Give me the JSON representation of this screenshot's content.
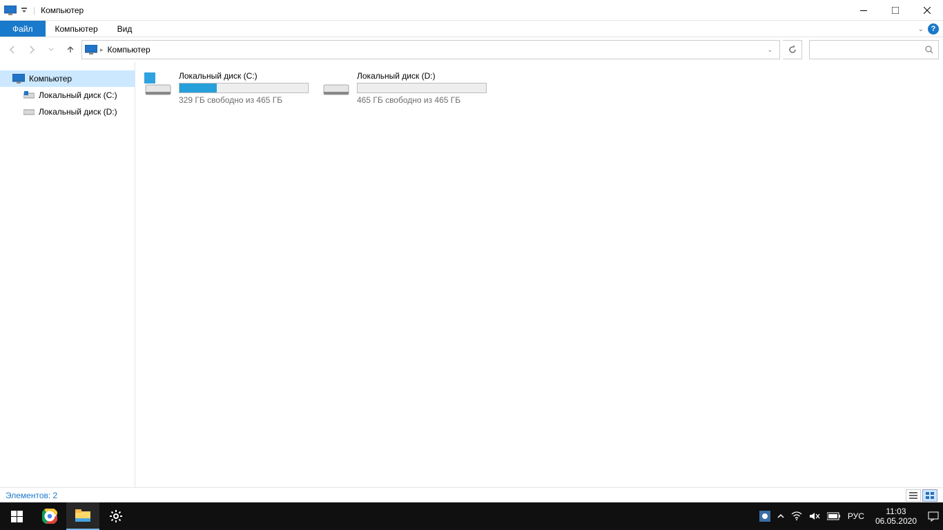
{
  "window": {
    "title": "Компьютер"
  },
  "ribbon": {
    "file": "Файл",
    "computer": "Компьютер",
    "view": "Вид"
  },
  "breadcrumb": {
    "root": "Компьютер"
  },
  "sidebar": {
    "items": [
      {
        "label": "Компьютер"
      },
      {
        "label": "Локальный диск (C:)"
      },
      {
        "label": "Локальный диск (D:)"
      }
    ]
  },
  "drives": [
    {
      "name": "Локальный диск (C:)",
      "free_text": "329 ГБ свободно из 465 ГБ",
      "fill_pct": 29
    },
    {
      "name": "Локальный диск (D:)",
      "free_text": "465 ГБ свободно из 465 ГБ",
      "fill_pct": 0
    }
  ],
  "status": {
    "text": "Элементов: 2"
  },
  "taskbar": {
    "lang": "РУС",
    "time": "11:03",
    "date": "06.05.2020"
  }
}
